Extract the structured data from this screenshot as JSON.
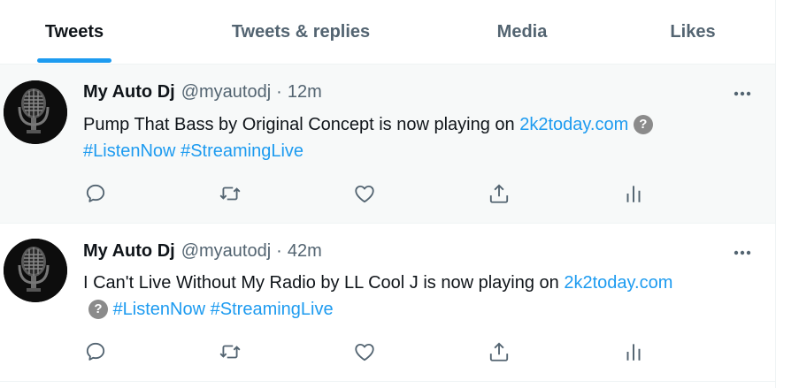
{
  "tabs": [
    {
      "label": "Tweets",
      "active": true
    },
    {
      "label": "Tweets & replies",
      "active": false
    },
    {
      "label": "Media",
      "active": false
    },
    {
      "label": "Likes",
      "active": false
    }
  ],
  "tweets": [
    {
      "author_name": "My Auto Dj",
      "author_handle": "@myautodj",
      "separator": "·",
      "time": "12m",
      "text_line1": "Pump That Bass by Original Concept  is now playing on ",
      "link": "2k2today.com",
      "unknown_glyph": "?",
      "hashtag1": "#ListenNow",
      "hashtag2": "#StreamingLive"
    },
    {
      "author_name": "My Auto Dj",
      "author_handle": "@myautodj",
      "separator": "·",
      "time": "42m",
      "text_line1": "I Can't Live Without My Radio by LL Cool J  is now playing on ",
      "link": "2k2today.com",
      "unknown_glyph": "?",
      "hashtag1": "#ListenNow",
      "hashtag2": "#StreamingLive"
    }
  ],
  "colors": {
    "accent": "#1d9bf0",
    "text_primary": "#0f1419",
    "text_secondary": "#536471",
    "hover_background": "#f7f9f9",
    "divider": "#eff3f4"
  },
  "icons": {
    "reply": "reply-icon",
    "retweet": "retweet-icon",
    "like": "like-icon",
    "share": "share-icon",
    "analytics": "analytics-icon",
    "more": "more-icon"
  }
}
